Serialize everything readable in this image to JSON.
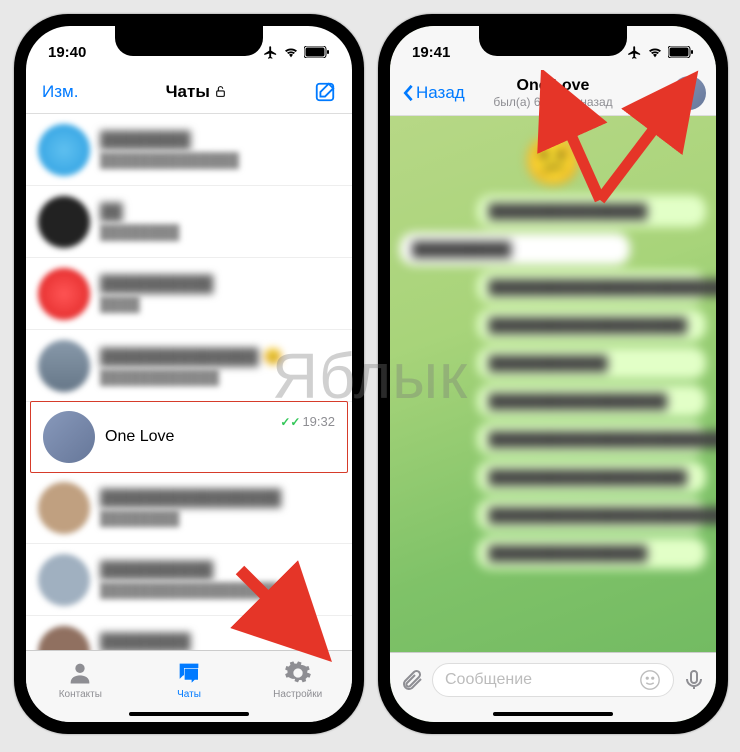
{
  "watermark": "Яблык",
  "left_phone": {
    "status": {
      "time": "19:40"
    },
    "header": {
      "edit": "Изм.",
      "title": "Чаты"
    },
    "chats": {
      "highlighted": {
        "name": "One Love",
        "time": "19:32"
      }
    },
    "tabbar": {
      "contacts": "Контакты",
      "chats": "Чаты",
      "settings": "Настройки"
    }
  },
  "right_phone": {
    "status": {
      "time": "19:41"
    },
    "header": {
      "back": "Назад",
      "title": "One Love",
      "subtitle": "был(а) 6 минут назад"
    },
    "input": {
      "placeholder": "Сообщение"
    }
  }
}
